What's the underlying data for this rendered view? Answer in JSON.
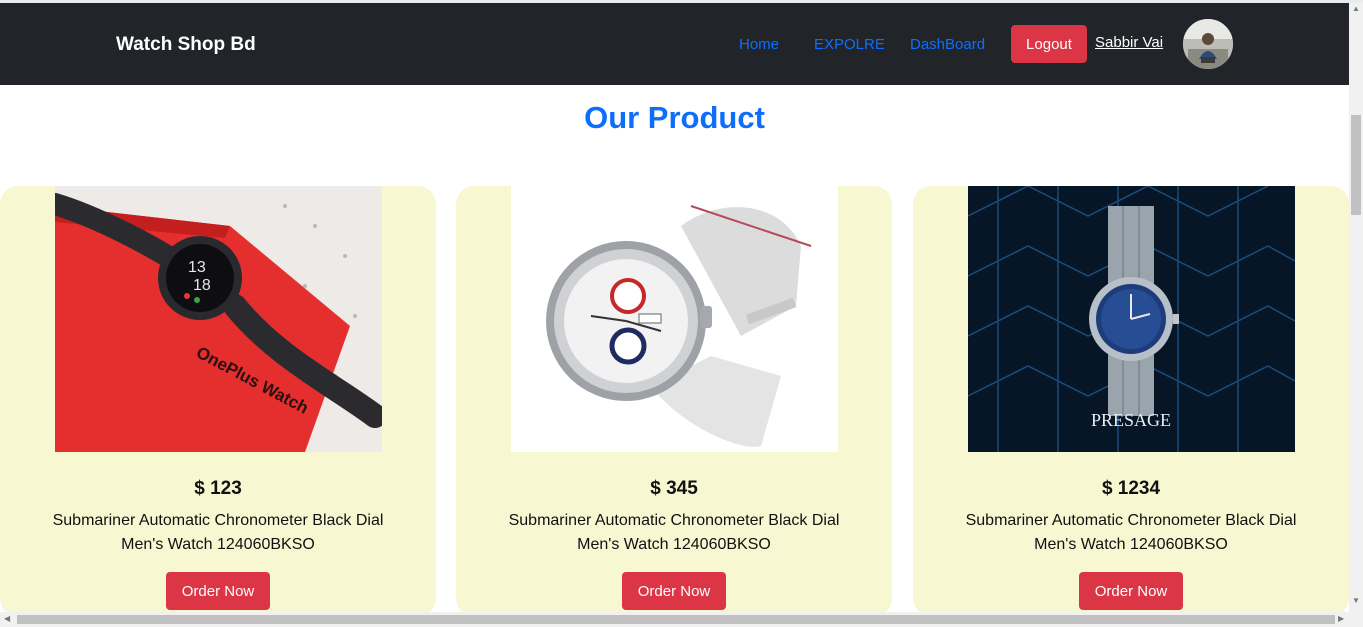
{
  "header": {
    "brand": "Watch Shop Bd",
    "nav": [
      "Home",
      "EXPOLRE",
      "DashBoard"
    ],
    "logout_label": "Logout",
    "user_name": "Sabbir Vai"
  },
  "main": {
    "title": "Our Product",
    "products": [
      {
        "price": "$ 123",
        "description": "Submariner Automatic Chronometer Black Dial Men's Watch 124060BKSO",
        "button": "Order Now",
        "image_text": "OnePlus Watch"
      },
      {
        "price": "$ 345",
        "description": "Submariner Automatic Chronometer Black Dial Men's Watch 124060BKSO",
        "button": "Order Now",
        "image_text": ""
      },
      {
        "price": "$ 1234",
        "description": "Submariner Automatic Chronometer Black Dial Men's Watch 124060BKSO",
        "button": "Order Now",
        "image_text": "PRESAGE"
      }
    ]
  },
  "colors": {
    "navbar": "#212529",
    "link": "#0d6efd",
    "danger": "#dc3545",
    "card_bg": "#f7f7d2"
  }
}
